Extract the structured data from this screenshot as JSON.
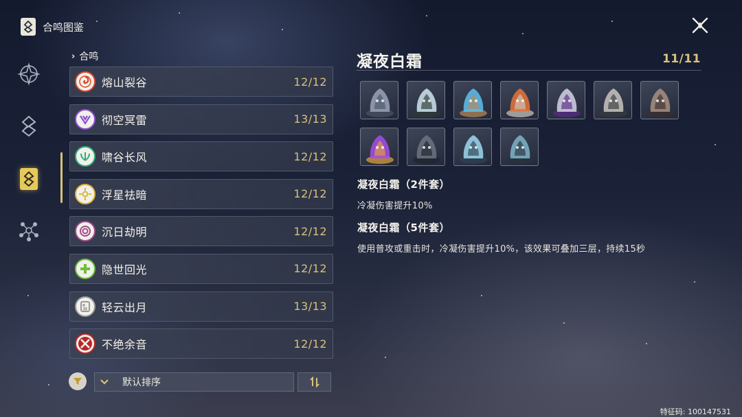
{
  "header": {
    "title": "合鸣图鉴"
  },
  "side_nav": {
    "items": [
      {
        "icon": "compass-emblem-icon"
      },
      {
        "icon": "layered-sigil-icon"
      },
      {
        "icon": "sonata-codex-icon",
        "active": true
      },
      {
        "icon": "constellation-network-icon"
      }
    ]
  },
  "list": {
    "header": "合鸣",
    "items": [
      {
        "name": "熔山裂谷",
        "count": "12/12",
        "color": "#d9492b",
        "icon": "swirl-flame-icon"
      },
      {
        "name": "彻空冥雷",
        "count": "13/13",
        "color": "#8e4fd6",
        "icon": "lightning-v-icon"
      },
      {
        "name": "啸谷长风",
        "count": "12/12",
        "color": "#2fae7a",
        "icon": "wind-wing-icon"
      },
      {
        "name": "浮星祛暗",
        "count": "12/12",
        "color": "#d8b43a",
        "icon": "sun-star-icon"
      },
      {
        "name": "沉日劫明",
        "count": "12/12",
        "color": "#a24a8e",
        "icon": "eclipse-spiral-icon"
      },
      {
        "name": "隐世回光",
        "count": "12/12",
        "color": "#6cbf3a",
        "icon": "healing-cross-icon"
      },
      {
        "name": "轻云出月",
        "count": "13/13",
        "color": "#9a9a9a",
        "icon": "cloud-moon-card-icon"
      },
      {
        "name": "不绝余音",
        "count": "12/12",
        "color": "#b8282a",
        "icon": "crossed-swords-icon"
      }
    ]
  },
  "controls": {
    "sort_label": "默认排序"
  },
  "detail": {
    "title": "凝夜白霜",
    "count": "11/11",
    "echoes": [
      {
        "icon": "hooded-blade-echo-icon",
        "palette": [
          "#9aa4b8",
          "#4a5468"
        ]
      },
      {
        "icon": "puffer-frog-echo-icon",
        "palette": [
          "#cfe6ee",
          "#2d3b33"
        ]
      },
      {
        "icon": "crystal-crab-echo-icon",
        "palette": [
          "#5ec0f0",
          "#b98a5a"
        ]
      },
      {
        "icon": "ember-crab-echo-icon",
        "palette": [
          "#e8733a",
          "#cfc9c0"
        ]
      },
      {
        "icon": "void-knight-echo-icon",
        "palette": [
          "#d6d4e6",
          "#5a2b8a"
        ]
      },
      {
        "icon": "armored-beast-echo-icon",
        "palette": [
          "#c9c6c0",
          "#3b3a3f"
        ]
      },
      {
        "icon": "horned-owl-echo-icon",
        "palette": [
          "#a79082",
          "#3a2e2c"
        ]
      },
      {
        "icon": "violet-flower-echo-icon",
        "palette": [
          "#a64de8",
          "#e5a53a"
        ]
      },
      {
        "icon": "shadow-golem-echo-icon",
        "palette": [
          "#6b7480",
          "#1f242e"
        ]
      },
      {
        "icon": "frost-dragon-echo-icon",
        "palette": [
          "#9fd8ef",
          "#2c4356"
        ]
      },
      {
        "icon": "frost-mech-echo-icon",
        "palette": [
          "#7fb5c9",
          "#2a313d"
        ]
      }
    ],
    "effects": [
      {
        "heading": "凝夜白霜（2件套）",
        "text": "冷凝伤害提升10%"
      },
      {
        "heading": "凝夜白霜（5件套）",
        "text": "使用普攻或重击时，冷凝伤害提升10%，该效果可叠加三层，持续15秒"
      }
    ]
  },
  "footer": {
    "uid": "特征码: 100147531"
  }
}
